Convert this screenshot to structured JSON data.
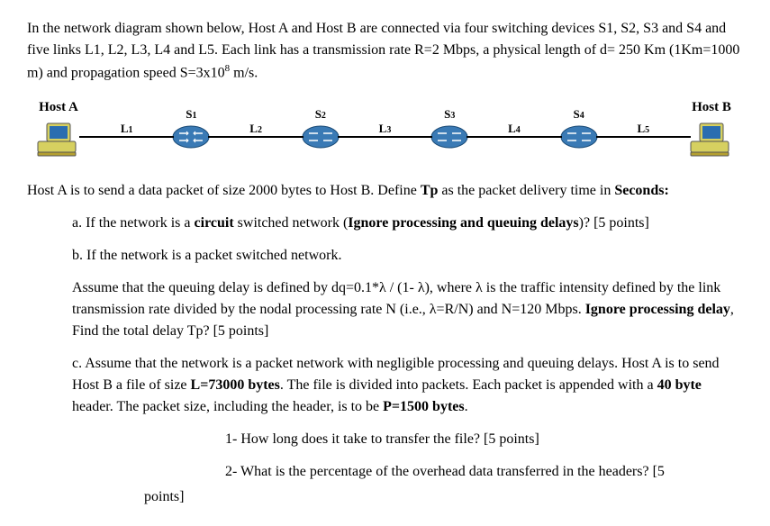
{
  "intro": "In the network diagram shown below, Host A and Host B are connected via four switching devices S1, S2, S3 and S4 and five links L1, L2, L3, L4 and L5. Each link has a transmission rate R=2 Mbps, a physical length of d= 250 Km (1Km=1000 m) and propagation speed S=3x10",
  "intro_sup": "8",
  "intro_tail": " m/s.",
  "hostA": "Host A",
  "hostB": "Host B",
  "links": [
    "L",
    "L",
    "L",
    "L",
    "L"
  ],
  "link_subs": [
    "1",
    "2",
    "3",
    "4",
    "5"
  ],
  "switches": [
    "S",
    "S",
    "S",
    "S"
  ],
  "switch_subs": [
    "1",
    "2",
    "3",
    "4"
  ],
  "body_lead": "Host A is to send a data packet of size 2000 bytes to Host B. Define ",
  "tp": "Tp",
  "body_lead2": " as the packet delivery time in ",
  "seconds": "Seconds:",
  "qa": "a. If the network is a ",
  "qa_b": "circuit",
  "qa2": " switched network (",
  "qa_b2": "Ignore processing and queuing delays",
  "qa3": ")? [5 points]",
  "qb": "b. If the network is a packet switched network.",
  "assume1": "Assume that the queuing delay is defined by dq=0.1*λ / (1- λ), where λ is the traffic intensity defined by the link transmission rate divided by the nodal processing rate N (i.e., λ=R/N) and N=120 Mbps. ",
  "assume_b": "Ignore processing delay",
  "assume2": ", Find the total delay Tp? [5 points]",
  "qc1": "c. Assume that the network is a packet network with negligible processing and queuing delays. Host A is to send Host B a file of size ",
  "qc_b1": "L=73000 bytes",
  "qc2": ". The file is divided into packets. Each packet is appended with a ",
  "qc_b2": "40 byte",
  "qc3": " header. The packet size, including the header, is to be ",
  "qc_b3": "P=1500 bytes",
  "qc4": ".",
  "sub1": "1- How long does it take to transfer the file? [5 points]",
  "sub2": "2- What is the percentage of the overhead data transferred in the headers? [5",
  "sub2b": "points]"
}
